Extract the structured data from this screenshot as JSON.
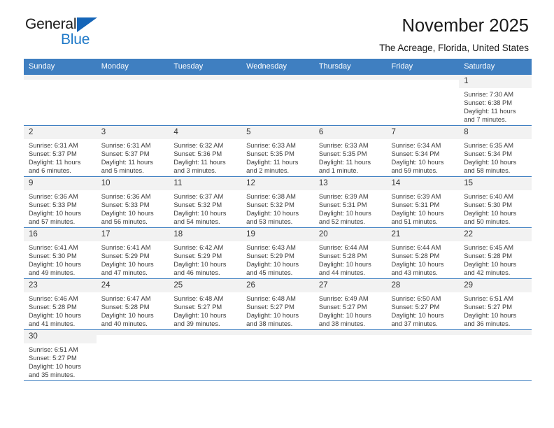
{
  "brand": {
    "name_top": "General",
    "name_bottom": "Blue",
    "accent_color": "#1f79c8",
    "mark_color": "#1565b8"
  },
  "header": {
    "title": "November 2025",
    "subtitle": "The Acreage, Florida, United States"
  },
  "calendar": {
    "header_bg": "#3f7fc1",
    "daynum_bg": "#f2f2f2",
    "weekday_headers": [
      "Sunday",
      "Monday",
      "Tuesday",
      "Wednesday",
      "Thursday",
      "Friday",
      "Saturday"
    ],
    "labels": {
      "sunrise": "Sunrise:",
      "sunset": "Sunset:",
      "daylight": "Daylight:"
    },
    "weeks": [
      [
        {
          "day": ""
        },
        {
          "day": ""
        },
        {
          "day": ""
        },
        {
          "day": ""
        },
        {
          "day": ""
        },
        {
          "day": ""
        },
        {
          "day": "1",
          "sunrise": "Sunrise: 7:30 AM",
          "sunset": "Sunset: 6:38 PM",
          "daylight": "Daylight: 11 hours and 7 minutes."
        }
      ],
      [
        {
          "day": "2",
          "sunrise": "Sunrise: 6:31 AM",
          "sunset": "Sunset: 5:37 PM",
          "daylight": "Daylight: 11 hours and 6 minutes."
        },
        {
          "day": "3",
          "sunrise": "Sunrise: 6:31 AM",
          "sunset": "Sunset: 5:37 PM",
          "daylight": "Daylight: 11 hours and 5 minutes."
        },
        {
          "day": "4",
          "sunrise": "Sunrise: 6:32 AM",
          "sunset": "Sunset: 5:36 PM",
          "daylight": "Daylight: 11 hours and 3 minutes."
        },
        {
          "day": "5",
          "sunrise": "Sunrise: 6:33 AM",
          "sunset": "Sunset: 5:35 PM",
          "daylight": "Daylight: 11 hours and 2 minutes."
        },
        {
          "day": "6",
          "sunrise": "Sunrise: 6:33 AM",
          "sunset": "Sunset: 5:35 PM",
          "daylight": "Daylight: 11 hours and 1 minute."
        },
        {
          "day": "7",
          "sunrise": "Sunrise: 6:34 AM",
          "sunset": "Sunset: 5:34 PM",
          "daylight": "Daylight: 10 hours and 59 minutes."
        },
        {
          "day": "8",
          "sunrise": "Sunrise: 6:35 AM",
          "sunset": "Sunset: 5:34 PM",
          "daylight": "Daylight: 10 hours and 58 minutes."
        }
      ],
      [
        {
          "day": "9",
          "sunrise": "Sunrise: 6:36 AM",
          "sunset": "Sunset: 5:33 PM",
          "daylight": "Daylight: 10 hours and 57 minutes."
        },
        {
          "day": "10",
          "sunrise": "Sunrise: 6:36 AM",
          "sunset": "Sunset: 5:33 PM",
          "daylight": "Daylight: 10 hours and 56 minutes."
        },
        {
          "day": "11",
          "sunrise": "Sunrise: 6:37 AM",
          "sunset": "Sunset: 5:32 PM",
          "daylight": "Daylight: 10 hours and 54 minutes."
        },
        {
          "day": "12",
          "sunrise": "Sunrise: 6:38 AM",
          "sunset": "Sunset: 5:32 PM",
          "daylight": "Daylight: 10 hours and 53 minutes."
        },
        {
          "day": "13",
          "sunrise": "Sunrise: 6:39 AM",
          "sunset": "Sunset: 5:31 PM",
          "daylight": "Daylight: 10 hours and 52 minutes."
        },
        {
          "day": "14",
          "sunrise": "Sunrise: 6:39 AM",
          "sunset": "Sunset: 5:31 PM",
          "daylight": "Daylight: 10 hours and 51 minutes."
        },
        {
          "day": "15",
          "sunrise": "Sunrise: 6:40 AM",
          "sunset": "Sunset: 5:30 PM",
          "daylight": "Daylight: 10 hours and 50 minutes."
        }
      ],
      [
        {
          "day": "16",
          "sunrise": "Sunrise: 6:41 AM",
          "sunset": "Sunset: 5:30 PM",
          "daylight": "Daylight: 10 hours and 49 minutes."
        },
        {
          "day": "17",
          "sunrise": "Sunrise: 6:41 AM",
          "sunset": "Sunset: 5:29 PM",
          "daylight": "Daylight: 10 hours and 47 minutes."
        },
        {
          "day": "18",
          "sunrise": "Sunrise: 6:42 AM",
          "sunset": "Sunset: 5:29 PM",
          "daylight": "Daylight: 10 hours and 46 minutes."
        },
        {
          "day": "19",
          "sunrise": "Sunrise: 6:43 AM",
          "sunset": "Sunset: 5:29 PM",
          "daylight": "Daylight: 10 hours and 45 minutes."
        },
        {
          "day": "20",
          "sunrise": "Sunrise: 6:44 AM",
          "sunset": "Sunset: 5:28 PM",
          "daylight": "Daylight: 10 hours and 44 minutes."
        },
        {
          "day": "21",
          "sunrise": "Sunrise: 6:44 AM",
          "sunset": "Sunset: 5:28 PM",
          "daylight": "Daylight: 10 hours and 43 minutes."
        },
        {
          "day": "22",
          "sunrise": "Sunrise: 6:45 AM",
          "sunset": "Sunset: 5:28 PM",
          "daylight": "Daylight: 10 hours and 42 minutes."
        }
      ],
      [
        {
          "day": "23",
          "sunrise": "Sunrise: 6:46 AM",
          "sunset": "Sunset: 5:28 PM",
          "daylight": "Daylight: 10 hours and 41 minutes."
        },
        {
          "day": "24",
          "sunrise": "Sunrise: 6:47 AM",
          "sunset": "Sunset: 5:28 PM",
          "daylight": "Daylight: 10 hours and 40 minutes."
        },
        {
          "day": "25",
          "sunrise": "Sunrise: 6:48 AM",
          "sunset": "Sunset: 5:27 PM",
          "daylight": "Daylight: 10 hours and 39 minutes."
        },
        {
          "day": "26",
          "sunrise": "Sunrise: 6:48 AM",
          "sunset": "Sunset: 5:27 PM",
          "daylight": "Daylight: 10 hours and 38 minutes."
        },
        {
          "day": "27",
          "sunrise": "Sunrise: 6:49 AM",
          "sunset": "Sunset: 5:27 PM",
          "daylight": "Daylight: 10 hours and 38 minutes."
        },
        {
          "day": "28",
          "sunrise": "Sunrise: 6:50 AM",
          "sunset": "Sunset: 5:27 PM",
          "daylight": "Daylight: 10 hours and 37 minutes."
        },
        {
          "day": "29",
          "sunrise": "Sunrise: 6:51 AM",
          "sunset": "Sunset: 5:27 PM",
          "daylight": "Daylight: 10 hours and 36 minutes."
        }
      ],
      [
        {
          "day": "30",
          "sunrise": "Sunrise: 6:51 AM",
          "sunset": "Sunset: 5:27 PM",
          "daylight": "Daylight: 10 hours and 35 minutes."
        },
        {
          "day": ""
        },
        {
          "day": ""
        },
        {
          "day": ""
        },
        {
          "day": ""
        },
        {
          "day": ""
        },
        {
          "day": ""
        }
      ]
    ]
  }
}
